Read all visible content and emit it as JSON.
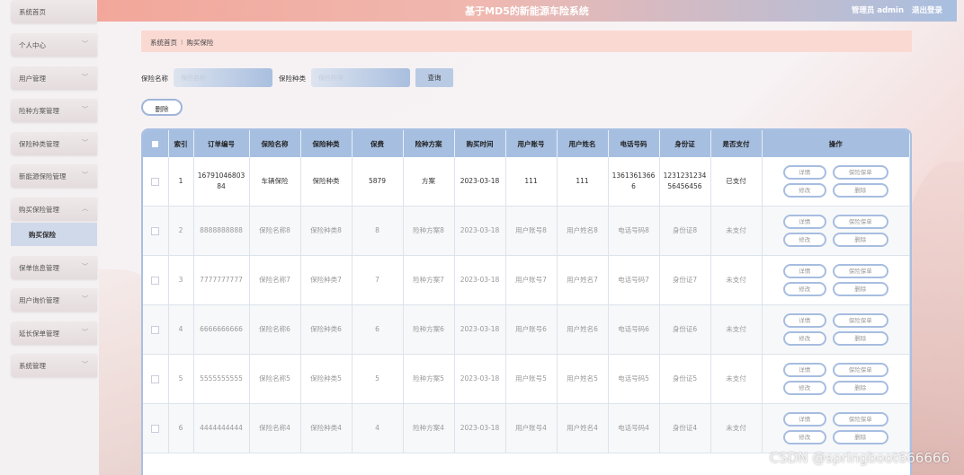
{
  "header": {
    "title": "基于MD5的新能源车险系统",
    "user_label": "管理员 admin",
    "logout": "退出登录"
  },
  "sidebar": {
    "items": [
      {
        "label": "系统首页"
      },
      {
        "label": "个人中心"
      },
      {
        "label": "用户管理"
      },
      {
        "label": "险种方案管理"
      },
      {
        "label": "保险种类管理"
      },
      {
        "label": "新能源保险管理"
      },
      {
        "label": "购买保险管理",
        "expanded": true,
        "sub": "购买保险"
      },
      {
        "label": "保单信息管理"
      },
      {
        "label": "用户询价管理"
      },
      {
        "label": "延长保单管理"
      },
      {
        "label": "系统管理"
      }
    ]
  },
  "breadcrumb": {
    "home": "系统首页",
    "current": "购买保险"
  },
  "search": {
    "name_label": "保险名称",
    "name_placeholder": "保险名称",
    "type_label": "保险种类",
    "type_placeholder": "保险种类",
    "query_button": "查询",
    "delete_button": "删除"
  },
  "table": {
    "headers": [
      "",
      "索引",
      "订单编号",
      "保险名称",
      "保险种类",
      "保费",
      "险种方案",
      "购买时间",
      "用户账号",
      "用户姓名",
      "电话号码",
      "身份证",
      "是否支付",
      "操作"
    ],
    "rows": [
      [
        "1",
        "1679104680384",
        "车辆保险",
        "保险种类",
        "5879",
        "方案",
        "2023-03-18",
        "111",
        "111",
        "13613613666",
        "123123123456456456",
        "已支付"
      ],
      [
        "2",
        "8888888888",
        "保险名称8",
        "保险种类8",
        "8",
        "险种方案8",
        "2023-03-18",
        "用户账号8",
        "用户姓名8",
        "电话号码8",
        "身份证8",
        "未支付"
      ],
      [
        "3",
        "7777777777",
        "保险名称7",
        "保险种类7",
        "7",
        "险种方案7",
        "2023-03-18",
        "用户账号7",
        "用户姓名7",
        "电话号码7",
        "身份证7",
        "未支付"
      ],
      [
        "4",
        "6666666666",
        "保险名称6",
        "保险种类6",
        "6",
        "险种方案6",
        "2023-03-18",
        "用户账号6",
        "用户姓名6",
        "电话号码6",
        "身份证6",
        "未支付"
      ],
      [
        "5",
        "5555555555",
        "保险名称5",
        "保险种类5",
        "5",
        "险种方案5",
        "2023-03-18",
        "用户账号5",
        "用户姓名5",
        "电话号码5",
        "身份证5",
        "未支付"
      ],
      [
        "6",
        "4444444444",
        "保险名称4",
        "保险种类4",
        "4",
        "险种方案4",
        "2023-03-18",
        "用户账号4",
        "用户姓名4",
        "电话号码4",
        "身份证4",
        "未支付"
      ]
    ],
    "ops": [
      "详情",
      "保险保单",
      "修改",
      "删除"
    ]
  },
  "watermark": "CSDN @springboot666666"
}
